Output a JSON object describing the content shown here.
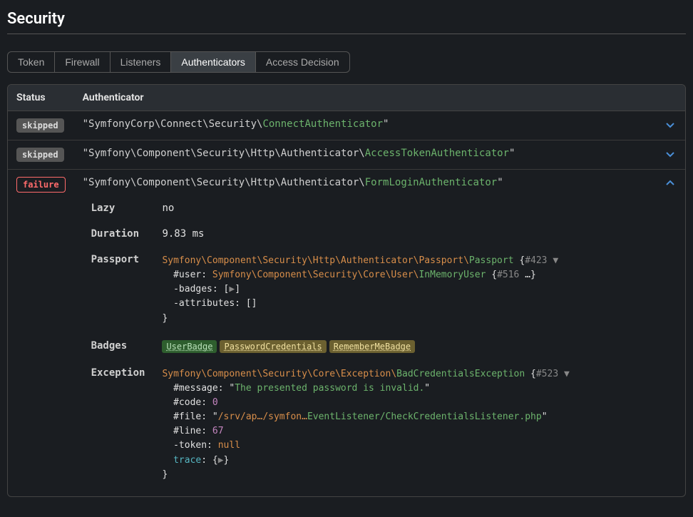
{
  "title": "Security",
  "tabs": [
    "Token",
    "Firewall",
    "Listeners",
    "Authenticators",
    "Access Decision"
  ],
  "activeTab": 3,
  "columns": {
    "status": "Status",
    "auth": "Authenticator"
  },
  "rows": [
    {
      "status": "skipped",
      "statusClass": "badge-skipped",
      "ns": "SymfonyCorp\\Connect\\Security\\",
      "cls": "ConnectAuthenticator",
      "expanded": false
    },
    {
      "status": "skipped",
      "statusClass": "badge-skipped",
      "ns": "Symfony\\Component\\Security\\Http\\Authenticator\\",
      "cls": "AccessTokenAuthenticator",
      "expanded": false
    },
    {
      "status": "failure",
      "statusClass": "badge-failure",
      "ns": "Symfony\\Component\\Security\\Http\\Authenticator\\",
      "cls": "FormLoginAuthenticator",
      "expanded": true,
      "details": {
        "Lazy": "no",
        "Duration": "9.83 ms",
        "passport": {
          "cls_ns": "Symfony\\Component\\Security\\Http\\Authenticator\\Passport\\",
          "cls": "Passport",
          "ref": "#423",
          "user_ns": "Symfony\\Component\\Security\\Core\\User\\",
          "user_cls": "InMemoryUser",
          "user_ref": "#516"
        },
        "badges": [
          {
            "label": "UserBadge",
            "class": "pill-resolved"
          },
          {
            "label": "PasswordCredentials",
            "class": "pill-unresolved"
          },
          {
            "label": "RememberMeBadge",
            "class": "pill-unresolved"
          }
        ],
        "exception": {
          "cls_ns": "Symfony\\Component\\Security\\Core\\Exception\\",
          "cls": "BadCredentialsException",
          "ref": "#523",
          "message": "The presented password is invalid.",
          "code": "0",
          "file_prefix": "/srv/ap…/symfon…",
          "file_tail": "EventListener/CheckCredentialsListener.php",
          "line": "67",
          "token": "null"
        }
      }
    }
  ],
  "labels": {
    "lazy": "Lazy",
    "duration": "Duration",
    "passport": "Passport",
    "badges": "Badges",
    "exception": "Exception",
    "user_prop": "#user",
    "badges_prop": "-badges",
    "attrs_prop": "-attributes",
    "message_prop": "#message",
    "code_prop": "#code",
    "file_prop": "#file",
    "line_prop": "#line",
    "token_prop": "-token",
    "trace_prop": "trace"
  }
}
